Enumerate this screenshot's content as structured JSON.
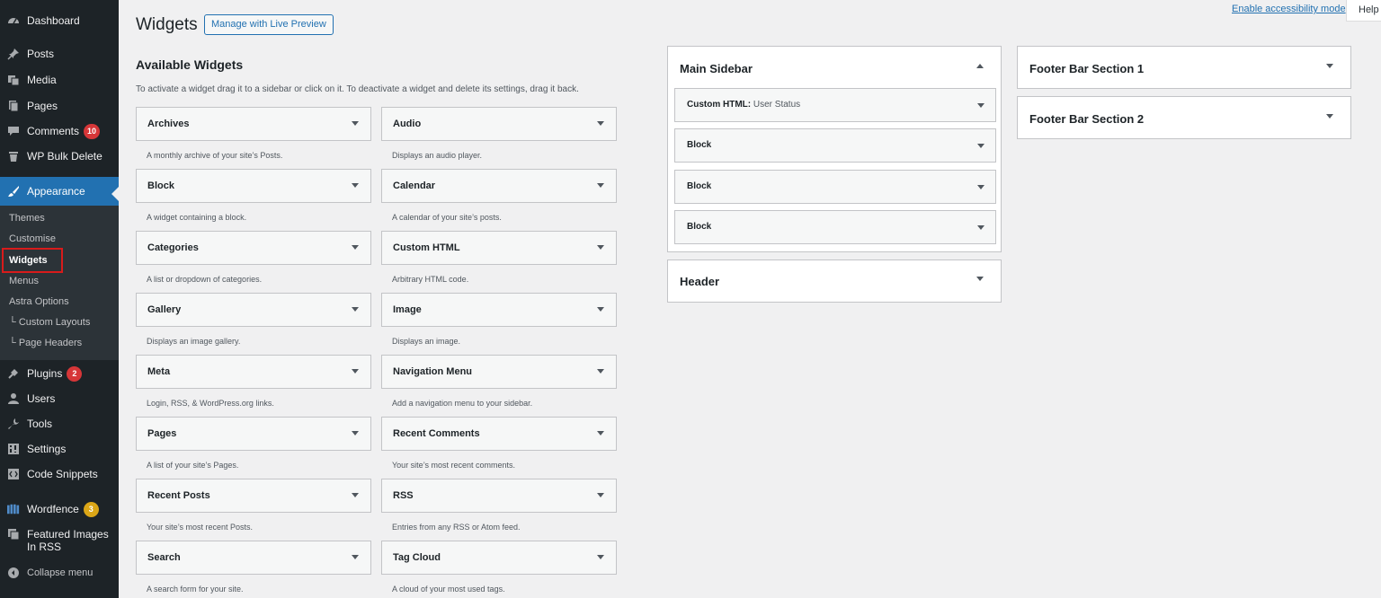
{
  "sidebar": {
    "items": [
      {
        "label": "Dashboard",
        "icon": "dashboard-icon",
        "badge": ""
      },
      {
        "label": "Posts",
        "icon": "pin-icon",
        "badge": ""
      },
      {
        "label": "Media",
        "icon": "media-icon",
        "badge": ""
      },
      {
        "label": "Pages",
        "icon": "page-icon",
        "badge": ""
      },
      {
        "label": "Comments",
        "icon": "comment-icon",
        "badge": "10"
      },
      {
        "label": "WP Bulk Delete",
        "icon": "trash-icon",
        "badge": ""
      },
      {
        "label": "Appearance",
        "icon": "paintbrush-icon",
        "badge": ""
      },
      {
        "label": "Plugins",
        "icon": "plug-icon",
        "badge": "2"
      },
      {
        "label": "Users",
        "icon": "user-icon",
        "badge": ""
      },
      {
        "label": "Tools",
        "icon": "wrench-icon",
        "badge": ""
      },
      {
        "label": "Settings",
        "icon": "settings-icon",
        "badge": ""
      },
      {
        "label": "Code Snippets",
        "icon": "code-icon",
        "badge": ""
      },
      {
        "label": "Wordfence",
        "icon": "wordfence-icon",
        "badge": "3"
      },
      {
        "label": "Featured Images",
        "label2": "In RSS",
        "icon": "rss-image-icon",
        "badge": ""
      },
      {
        "label": "Collapse menu",
        "icon": "collapse-icon",
        "badge": ""
      }
    ],
    "submenu": [
      "Themes",
      "Customise",
      "Widgets",
      "Menus",
      "Astra Options",
      "└ Custom Layouts",
      "└ Page Headers"
    ]
  },
  "topbar": {
    "accessibility_link": "Enable accessibility mode",
    "help": "Help"
  },
  "header": {
    "title": "Widgets",
    "live_preview": "Manage with Live Preview"
  },
  "available": {
    "title": "Available Widgets",
    "description": "To activate a widget drag it to a sidebar or click on it. To deactivate a widget and delete its settings, drag it back.",
    "widgets": [
      {
        "name": "Archives",
        "desc": "A monthly archive of your site’s Posts."
      },
      {
        "name": "Audio",
        "desc": "Displays an audio player."
      },
      {
        "name": "Block",
        "desc": "A widget containing a block."
      },
      {
        "name": "Calendar",
        "desc": "A calendar of your site’s posts."
      },
      {
        "name": "Categories",
        "desc": "A list or dropdown of categories."
      },
      {
        "name": "Custom HTML",
        "desc": "Arbitrary HTML code."
      },
      {
        "name": "Gallery",
        "desc": "Displays an image gallery."
      },
      {
        "name": "Image",
        "desc": "Displays an image."
      },
      {
        "name": "Meta",
        "desc": "Login, RSS, & WordPress.org links."
      },
      {
        "name": "Navigation Menu",
        "desc": "Add a navigation menu to your sidebar."
      },
      {
        "name": "Pages",
        "desc": "A list of your site’s Pages."
      },
      {
        "name": "Recent Comments",
        "desc": "Your site’s most recent comments."
      },
      {
        "name": "Recent Posts",
        "desc": "Your site’s most recent Posts."
      },
      {
        "name": "RSS",
        "desc": "Entries from any RSS or Atom feed."
      },
      {
        "name": "Search",
        "desc": "A search form for your site."
      },
      {
        "name": "Tag Cloud",
        "desc": "A cloud of your most used tags."
      }
    ]
  },
  "areas": {
    "main_sidebar": {
      "title": "Main Sidebar",
      "widgets": [
        {
          "name": "Custom HTML:",
          "sub": "User Status"
        },
        {
          "name": "Block",
          "sub": ""
        },
        {
          "name": "Block",
          "sub": ""
        },
        {
          "name": "Block",
          "sub": ""
        }
      ]
    },
    "header": {
      "title": "Header"
    },
    "footer1": {
      "title": "Footer Bar Section 1"
    },
    "footer2": {
      "title": "Footer Bar Section 2"
    }
  },
  "colors": {
    "admin_bg": "#1d2327",
    "accent": "#2271b1",
    "badge_red": "#d63638",
    "badge_yellow": "#dba617",
    "highlight_box": "#d81b1b"
  }
}
